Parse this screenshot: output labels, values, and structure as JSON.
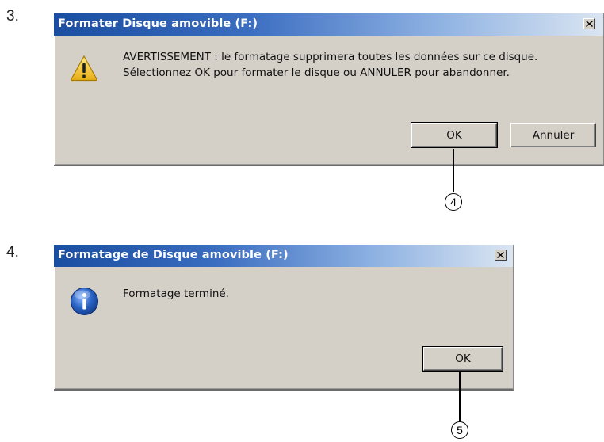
{
  "steps": [
    {
      "number": "3.",
      "dialog": {
        "title": "Formater Disque amovible (F:)",
        "icon": "warning-icon",
        "message_lines": [
          "AVERTISSEMENT : le formatage supprimera toutes les données sur ce disque.",
          "Sélectionnez OK pour formater le disque ou ANNULER pour abandonner."
        ],
        "buttons": {
          "ok": "OK",
          "cancel": "Annuler"
        }
      },
      "callout": "4"
    },
    {
      "number": "4.",
      "dialog": {
        "title": "Formatage de Disque amovible (F:)",
        "icon": "info-icon",
        "message_lines": [
          "Formatage terminé."
        ],
        "buttons": {
          "ok": "OK"
        }
      },
      "callout": "5"
    }
  ],
  "colors": {
    "dialog_background": "#d4d0c8",
    "titlebar_start": "#1a4ea0",
    "titlebar_end": "#dbe5f2",
    "warning_yellow": "#f2c21c",
    "info_blue": "#2a63c4"
  }
}
